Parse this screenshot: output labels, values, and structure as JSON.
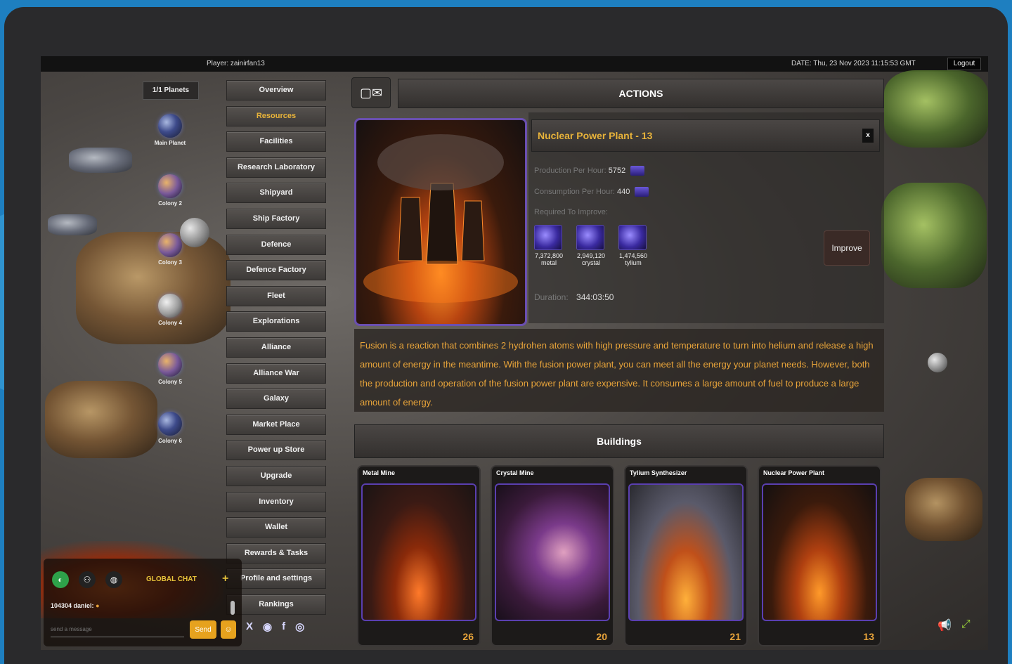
{
  "topbar": {
    "player": "Player: zainirfan13",
    "date": "DATE: Thu, 23 Nov 2023 11:15:53 GMT",
    "logout_label": "Logout"
  },
  "planets": {
    "badge": "1/1 Planets",
    "items": [
      {
        "name": "Main Planet"
      },
      {
        "name": "Colony 2"
      },
      {
        "name": "Colony 3"
      },
      {
        "name": "Colony 4"
      },
      {
        "name": "Colony 5"
      },
      {
        "name": "Colony 6"
      }
    ]
  },
  "nav": {
    "active": "Resources",
    "items": [
      "Overview",
      "Resources",
      "Facilities",
      "Research Laboratory",
      "Shipyard",
      "Ship Factory",
      "Defence",
      "Defence Factory",
      "Fleet",
      "Explorations",
      "Alliance",
      "Alliance War",
      "Galaxy",
      "Market Place",
      "Power up Store",
      "Upgrade",
      "Inventory",
      "Wallet",
      "Rewards & Tasks",
      "Profile and settings",
      "Rankings"
    ]
  },
  "socials": {
    "x": "X",
    "discord": "◉",
    "facebook": "f",
    "instagram": "◎"
  },
  "chat": {
    "title": "GLOBAL CHAT",
    "plus": "+",
    "message_user": "104304 daniel:",
    "message_emoji": "●",
    "input_placeholder": "send a message",
    "send_label": "Send",
    "emoji_icon": "☺"
  },
  "actions": {
    "title": "ACTIONS",
    "msg_icon": "▢✉"
  },
  "building": {
    "title": "Nuclear Power Plant - 13",
    "close": "x",
    "production_label": "Production Per Hour:",
    "production_value": "5752",
    "consumption_label": "Consumption Per Hour:",
    "consumption_value": "440",
    "required_label": "Required To Improve:",
    "requirements": [
      {
        "value": "7,372,800",
        "label": "metal"
      },
      {
        "value": "2,949,120",
        "label": "crystal"
      },
      {
        "value": "1,474,560",
        "label": "tylium"
      }
    ],
    "improve_label": "Improve",
    "duration_label": "Duration:",
    "duration_value": "344:03:50",
    "description": "Fusion is a reaction that combines 2 hydrohen atoms with high pressure and temperature to turn into helium and release a high amount of energy in the meantime. With the fusion power plant, you can meet all the energy your planet needs. However, both the production and operation of the fusion power plant are expensive. It consumes a large amount of fuel to produce a large amount of energy."
  },
  "buildings": {
    "title": "Buildings",
    "cards": [
      {
        "name": "Metal Mine",
        "level": "26"
      },
      {
        "name": "Crystal Mine",
        "level": "20"
      },
      {
        "name": "Tylium Synthesizer",
        "level": "21"
      },
      {
        "name": "Nuclear Power Plant",
        "level": "13"
      }
    ]
  },
  "corner": {
    "megaphone": "📢",
    "expand": "⤢"
  }
}
